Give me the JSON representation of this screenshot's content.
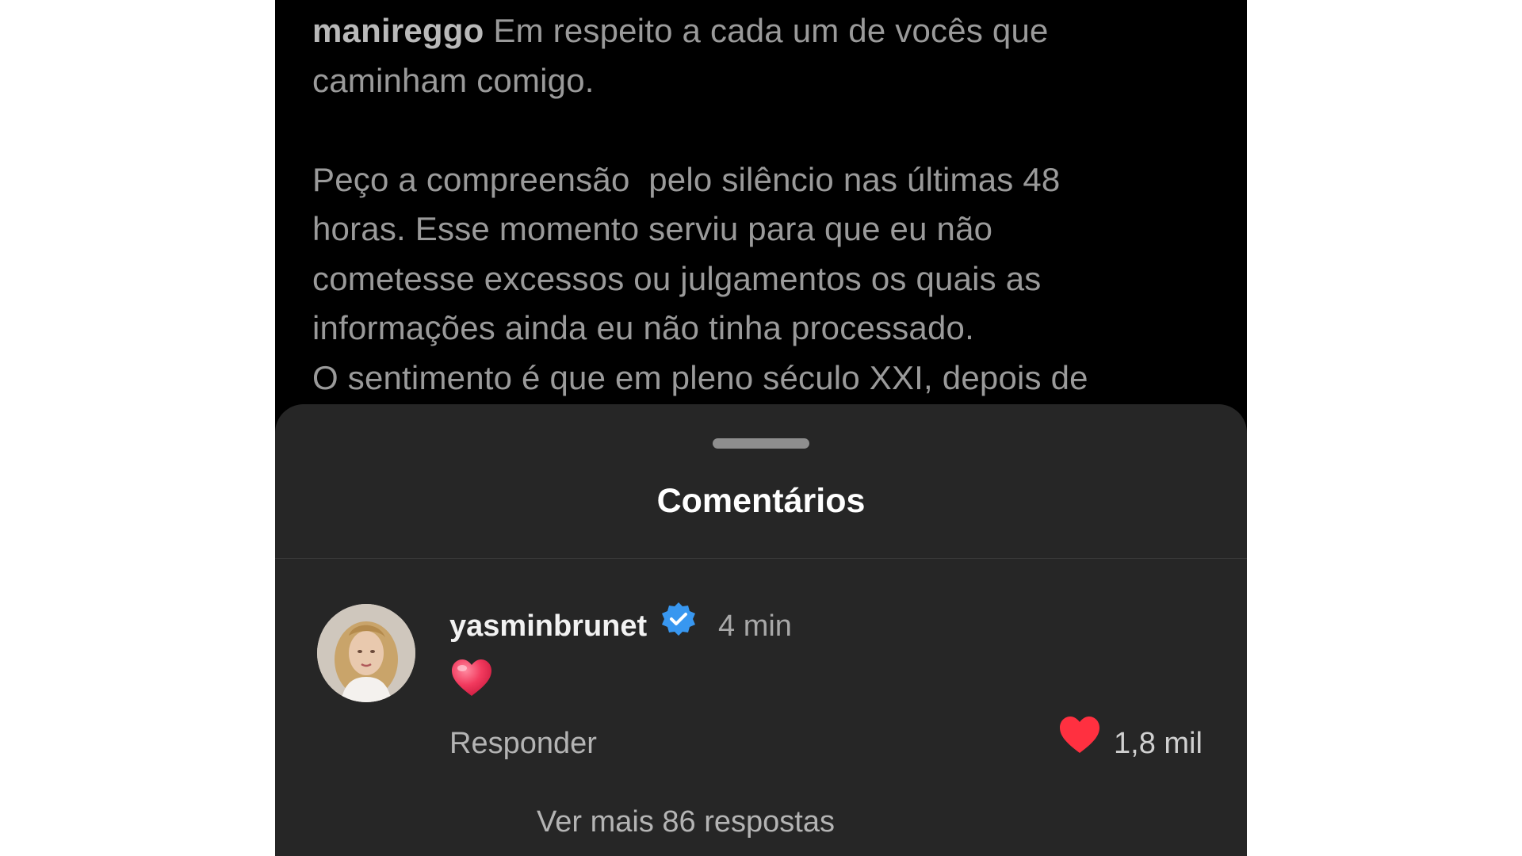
{
  "post": {
    "username": "manireggo",
    "caption_lead": " Em respeito a cada um de vocês que\ncaminham comigo.\n\nPeço a compreensão  pelo silêncio nas últimas 48\nhoras. Esse momento serviu para que eu não\ncometesse excessos ou julgamentos os quais as\ninformações ainda eu não tinha processado.\nO sentimento é que em pleno século XXI, depois de"
  },
  "sheet": {
    "title": "Comentários"
  },
  "comment": {
    "username": "yasminbrunet",
    "time": "4 min",
    "reply_label": "Responder",
    "like_count": "1,8 mil",
    "more_replies": "Ver mais 86 respostas",
    "avatar_icon": "user-avatar",
    "verified_icon": "verified-badge-icon",
    "emoji_icon": "red-heart-emoji"
  },
  "colors": {
    "background": "#000000",
    "sheet": "#262626",
    "verified": "#3897f0",
    "like": "#ff3040"
  }
}
